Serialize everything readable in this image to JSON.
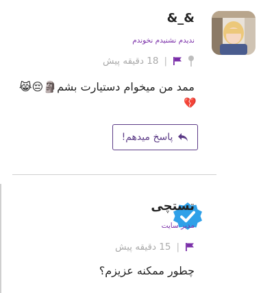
{
  "comments": [
    {
      "author": "&_&",
      "role": "ندیدم نشنیدم نخوندم",
      "time": "18 دقیقه پیش",
      "text": "ممد من میخوام دستیارت بشم🗿😔😹",
      "text_tail": "💔",
      "reply_label": "پاسخ میدهم!",
      "icons": {
        "pin": "pin-icon",
        "flag": "flag-icon",
        "reply": "reply-arrow-icon"
      }
    },
    {
      "author": "تستچی",
      "role": "مدیر سایت",
      "time": "15 دقیقه پیش",
      "text": "چطور ممکنه عزیزم؟",
      "icons": {
        "badge": "verified-badge-icon",
        "flag": "flag-icon"
      }
    }
  ],
  "colors": {
    "accent": "#7a2ea8",
    "badge": "#2fa0e8",
    "meta": "#aaaaaa"
  }
}
